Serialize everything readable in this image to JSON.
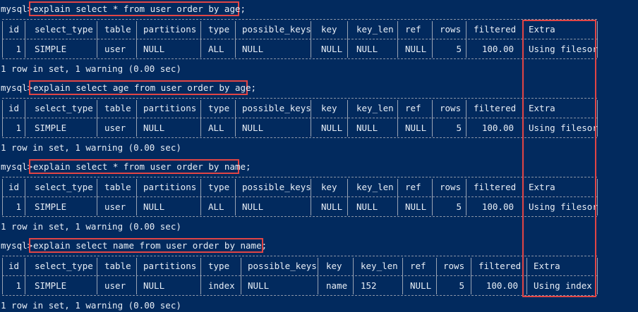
{
  "prompt": "mysql>",
  "blocks": [
    {
      "command": "explain select * from user order by age;",
      "headers": [
        "id",
        "select_type",
        "table",
        "partitions",
        "type",
        "possible_keys",
        "key",
        "key_len",
        "ref",
        "rows",
        "filtered",
        "Extra"
      ],
      "row": [
        "1",
        "SIMPLE",
        "user",
        "NULL",
        "ALL",
        "NULL",
        "NULL",
        "NULL",
        "NULL",
        "5",
        "100.00",
        "Using filesor"
      ],
      "summary": "1 row in set, 1 warning (0.00 sec)"
    },
    {
      "command": "explain select age from user order by age;",
      "headers": [
        "id",
        "select_type",
        "table",
        "partitions",
        "type",
        "possible_keys",
        "key",
        "key_len",
        "ref",
        "rows",
        "filtered",
        "Extra"
      ],
      "row": [
        "1",
        "SIMPLE",
        "user",
        "NULL",
        "ALL",
        "NULL",
        "NULL",
        "NULL",
        "NULL",
        "5",
        "100.00",
        "Using filesor"
      ],
      "summary": "1 row in set, 1 warning (0.00 sec)"
    },
    {
      "command": "explain select * from user order by name;",
      "headers": [
        "id",
        "select_type",
        "table",
        "partitions",
        "type",
        "possible_keys",
        "key",
        "key_len",
        "ref",
        "rows",
        "filtered",
        "Extra"
      ],
      "row": [
        "1",
        "SIMPLE",
        "user",
        "NULL",
        "ALL",
        "NULL",
        "NULL",
        "NULL",
        "NULL",
        "5",
        "100.00",
        "Using filesor"
      ],
      "summary": "1 row in set, 1 warning (0.00 sec)"
    },
    {
      "command": "explain select name from user order by name;",
      "headers": [
        "id",
        "select_type",
        "table",
        "partitions",
        "type",
        "possible_keys",
        "key",
        "key_len",
        "ref",
        "rows",
        "filtered",
        "Extra"
      ],
      "row": [
        "1",
        "SIMPLE",
        "user",
        "NULL",
        "index",
        "NULL",
        "name",
        "152",
        "NULL",
        "5",
        "100.00",
        "Using index"
      ],
      "summary": "1 row in set, 1 warning (0.00 sec)"
    }
  ],
  "colors": {
    "background": "#022A5E",
    "text": "#E8EEF6",
    "highlight_border": "#E24545"
  }
}
